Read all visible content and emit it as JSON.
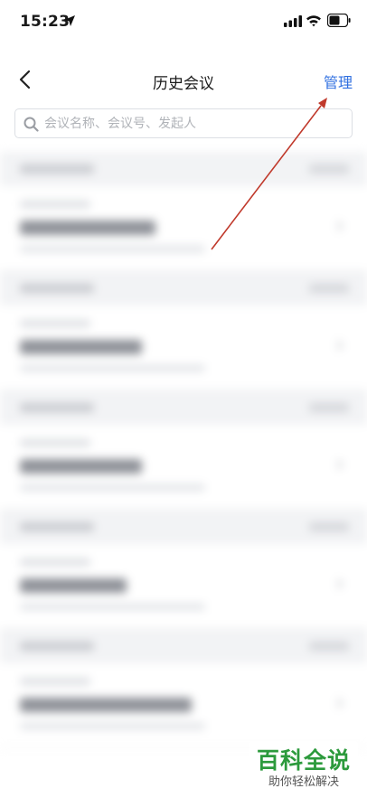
{
  "status_bar": {
    "time": "15:23",
    "icons": [
      "location-arrow-icon",
      "signal-icon",
      "wifi-icon",
      "battery-icon"
    ]
  },
  "nav": {
    "back_icon": "chevron-left-icon",
    "title": "历史会议",
    "manage_label": "管理"
  },
  "search": {
    "placeholder": "会议名称、会议号、发起人",
    "value": ""
  },
  "list": {
    "groups": [
      {
        "items": [
          {
            "title_width": 150
          }
        ]
      },
      {
        "items": [
          {
            "title_width": 135
          }
        ]
      },
      {
        "items": [
          {
            "title_width": 135
          }
        ]
      },
      {
        "items": [
          {
            "title_width": 118
          }
        ]
      },
      {
        "items": [
          {
            "title_width": 190
          }
        ]
      }
    ]
  },
  "colors": {
    "accent": "#2f6fe0",
    "annotation_arrow": "#c0392b",
    "watermark": "#2c9a3c"
  },
  "watermark": {
    "title": "百科全说",
    "subtitle": "助你轻松解决"
  }
}
